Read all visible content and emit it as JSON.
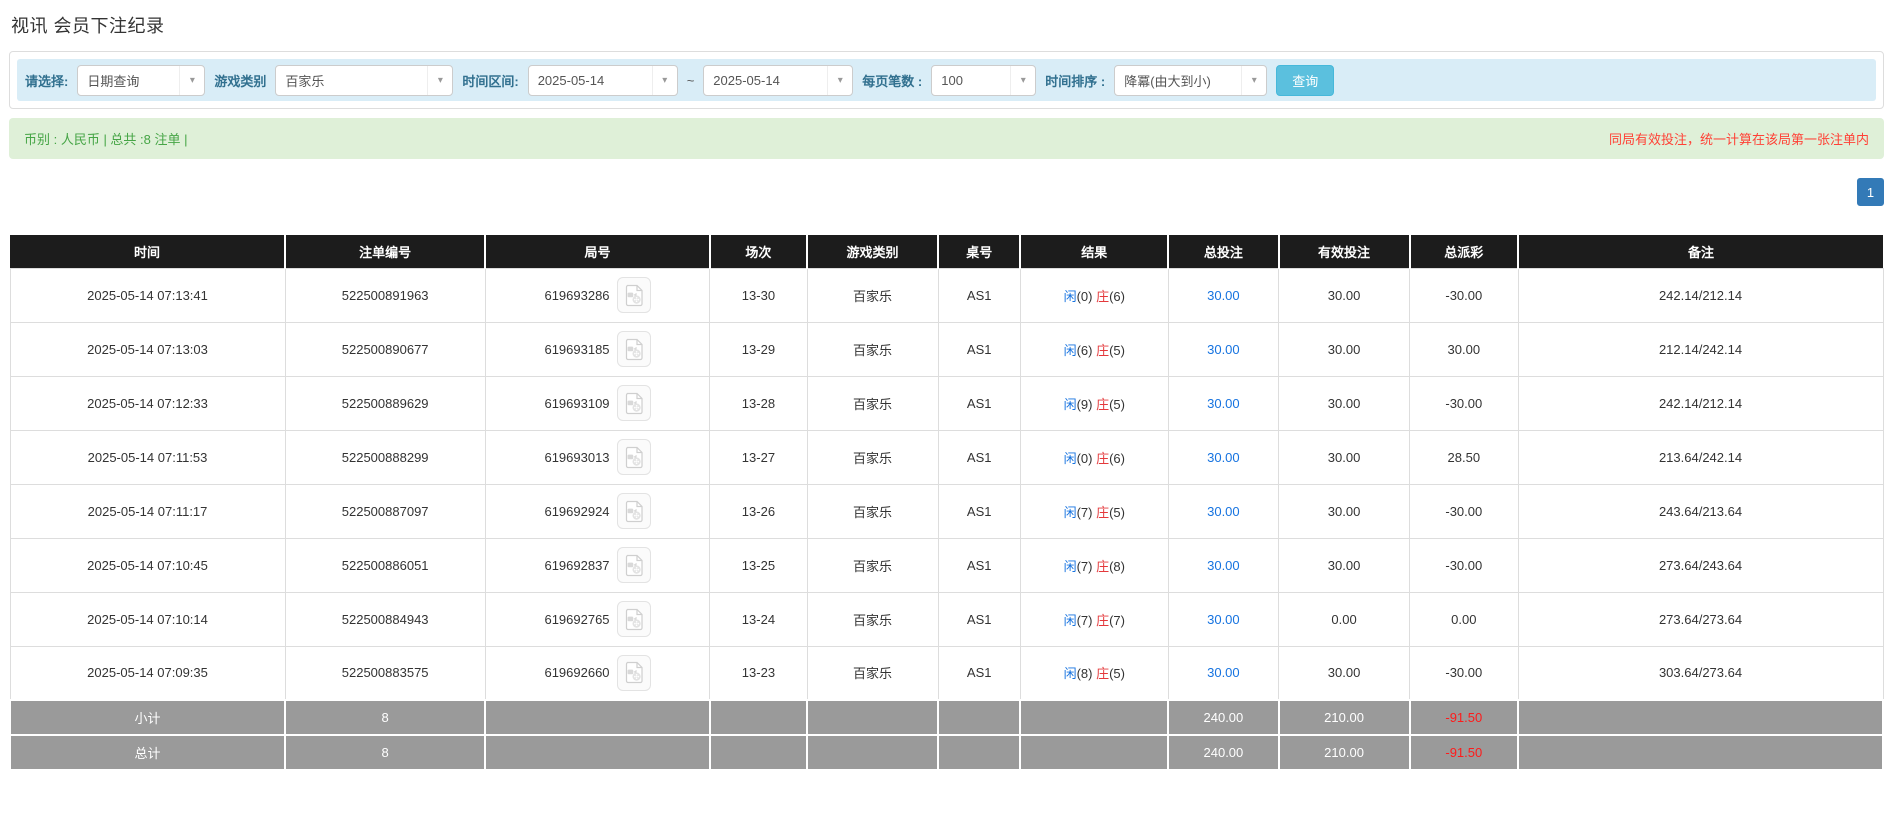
{
  "page": {
    "title": "视讯 会员下注纪录"
  },
  "icons": {
    "dropdown_arrow": "▾",
    "video_button_icon": "video-file-icon"
  },
  "colors": {
    "filter_bar_bg": "#d9edf7",
    "summary_bar_bg": "#dff0d8",
    "summary_text_green": "#46a546",
    "note_red": "#ff4136",
    "query_button_bg": "#5bc0de",
    "pagination_active_bg": "#337ab7",
    "table_header_bg": "#1c1c1c",
    "totals_row_bg": "#9a9a9a",
    "value_blue": "#1673e0",
    "banker_red": "#e4393c",
    "negative_red": "#ff0000"
  },
  "filters": {
    "mode_label": "请选择:",
    "mode_value": "日期查询",
    "game_type_label": "游戏类别",
    "game_type_value": "百家乐",
    "time_range_label": "时间区间:",
    "date_from": "2025-05-14",
    "tilde": "~",
    "date_to": "2025-05-14",
    "page_size_label": "每页笔数 :",
    "page_size_value": "100",
    "sort_label": "时间排序 :",
    "sort_value": "降冪(由大到小)",
    "query_button": "查询"
  },
  "summary_bar": {
    "left_text": "币别 : 人民币 | 总共 :8 注单 |",
    "right_note": "同局有效投注，统一计算在该局第一张注单内"
  },
  "pagination": {
    "current_page": "1"
  },
  "table": {
    "headers": [
      "时间",
      "注单编号",
      "局号",
      "场次",
      "游戏类别",
      "桌号",
      "结果",
      "总投注",
      "有效投注",
      "总派彩",
      "备注"
    ],
    "rows": [
      {
        "time": "2025-05-14 07:13:41",
        "bet_number": "522500891963",
        "round_number": "619693286",
        "session": "13-30",
        "game_type": "百家乐",
        "table_code": "AS1",
        "player_label": "闲",
        "player_score": "(0)",
        "banker_label": "庄",
        "banker_score": "(6)",
        "total_bet": "30.00",
        "valid_bet": "30.00",
        "payout": "-30.00",
        "remark": "242.14/212.14"
      },
      {
        "time": "2025-05-14 07:13:03",
        "bet_number": "522500890677",
        "round_number": "619693185",
        "session": "13-29",
        "game_type": "百家乐",
        "table_code": "AS1",
        "player_label": "闲",
        "player_score": "(6)",
        "banker_label": "庄",
        "banker_score": "(5)",
        "total_bet": "30.00",
        "valid_bet": "30.00",
        "payout": "30.00",
        "remark": "212.14/242.14"
      },
      {
        "time": "2025-05-14 07:12:33",
        "bet_number": "522500889629",
        "round_number": "619693109",
        "session": "13-28",
        "game_type": "百家乐",
        "table_code": "AS1",
        "player_label": "闲",
        "player_score": "(9)",
        "banker_label": "庄",
        "banker_score": "(5)",
        "total_bet": "30.00",
        "valid_bet": "30.00",
        "payout": "-30.00",
        "remark": "242.14/212.14"
      },
      {
        "time": "2025-05-14 07:11:53",
        "bet_number": "522500888299",
        "round_number": "619693013",
        "session": "13-27",
        "game_type": "百家乐",
        "table_code": "AS1",
        "player_label": "闲",
        "player_score": "(0)",
        "banker_label": "庄",
        "banker_score": "(6)",
        "total_bet": "30.00",
        "valid_bet": "30.00",
        "payout": "28.50",
        "remark": "213.64/242.14"
      },
      {
        "time": "2025-05-14 07:11:17",
        "bet_number": "522500887097",
        "round_number": "619692924",
        "session": "13-26",
        "game_type": "百家乐",
        "table_code": "AS1",
        "player_label": "闲",
        "player_score": "(7)",
        "banker_label": "庄",
        "banker_score": "(5)",
        "total_bet": "30.00",
        "valid_bet": "30.00",
        "payout": "-30.00",
        "remark": "243.64/213.64"
      },
      {
        "time": "2025-05-14 07:10:45",
        "bet_number": "522500886051",
        "round_number": "619692837",
        "session": "13-25",
        "game_type": "百家乐",
        "table_code": "AS1",
        "player_label": "闲",
        "player_score": "(7)",
        "banker_label": "庄",
        "banker_score": "(8)",
        "total_bet": "30.00",
        "valid_bet": "30.00",
        "payout": "-30.00",
        "remark": "273.64/243.64"
      },
      {
        "time": "2025-05-14 07:10:14",
        "bet_number": "522500884943",
        "round_number": "619692765",
        "session": "13-24",
        "game_type": "百家乐",
        "table_code": "AS1",
        "player_label": "闲",
        "player_score": "(7)",
        "banker_label": "庄",
        "banker_score": "(7)",
        "total_bet": "30.00",
        "valid_bet": "0.00",
        "payout": "0.00",
        "remark": "273.64/273.64"
      },
      {
        "time": "2025-05-14 07:09:35",
        "bet_number": "522500883575",
        "round_number": "619692660",
        "session": "13-23",
        "game_type": "百家乐",
        "table_code": "AS1",
        "player_label": "闲",
        "player_score": "(8)",
        "banker_label": "庄",
        "banker_score": "(5)",
        "total_bet": "30.00",
        "valid_bet": "30.00",
        "payout": "-30.00",
        "remark": "303.64/273.64"
      }
    ],
    "subtotal": {
      "label": "小计",
      "count": "8",
      "total_bet": "240.00",
      "valid_bet": "210.00",
      "payout": "-91.50"
    },
    "total": {
      "label": "总计",
      "count": "8",
      "total_bet": "240.00",
      "valid_bet": "210.00",
      "payout": "-91.50"
    }
  }
}
